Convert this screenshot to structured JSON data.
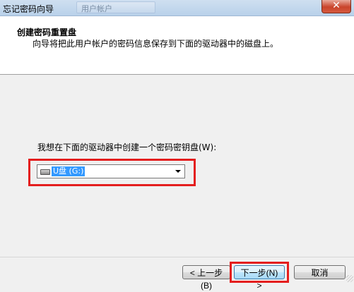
{
  "window": {
    "title": "忘记密码向导",
    "background_tab_title": "用户帐户",
    "close_label": "✕"
  },
  "header": {
    "title": "创建密码重置盘",
    "subtitle": "向导将把此用户帐户的密码信息保存到下面的驱动器中的磁盘上。"
  },
  "body": {
    "prompt": "我想在下面的驱动器中创建一个密码密钥盘(W):",
    "drive_select": {
      "selected": "U盘 (G:)",
      "icon": "usb-drive-icon"
    }
  },
  "buttons": {
    "back": "< 上一步(B)",
    "next": "下一步(N) >",
    "cancel": "取消"
  },
  "colors": {
    "highlight": "#e41e1e",
    "selection": "#3399ff",
    "dialog_bg": "#f0f0f0",
    "header_bg": "#ffffff"
  }
}
